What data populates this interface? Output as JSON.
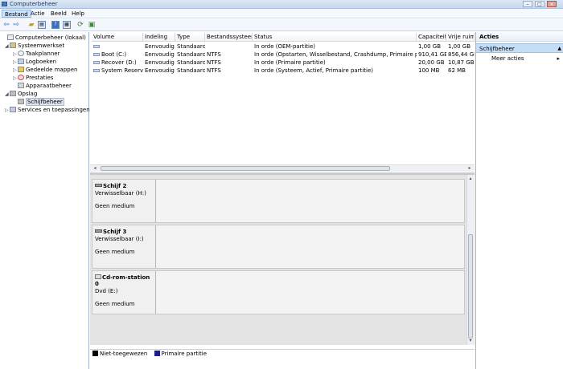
{
  "window": {
    "title": "Computerbeheer"
  },
  "menu": [
    {
      "label": "Bestand",
      "active": true
    },
    {
      "label": "Actie",
      "active": false
    },
    {
      "label": "Beeld",
      "active": false
    },
    {
      "label": "Help",
      "active": false
    }
  ],
  "toolbar": {
    "icons": [
      "back-arrow-icon",
      "forward-arrow-icon",
      "up-folder-icon",
      "console-tree-icon",
      "help-icon",
      "properties-icon",
      "refresh-icon",
      "export-icon"
    ]
  },
  "tree": [
    {
      "label": "Computerbeheer (lokaal)",
      "level": 0,
      "expander": "",
      "icon": "computer-icon"
    },
    {
      "label": "Systeemwerkset",
      "level": 1,
      "expander": "◢",
      "icon": "tools-icon"
    },
    {
      "label": "Taakplanner",
      "level": 2,
      "expander": "▷",
      "icon": "clock-icon"
    },
    {
      "label": "Logboeken",
      "level": 2,
      "expander": "▷",
      "icon": "log-icon"
    },
    {
      "label": "Gedeelde mappen",
      "level": 2,
      "expander": "▷",
      "icon": "shared-folder-icon"
    },
    {
      "label": "Prestaties",
      "level": 2,
      "expander": "▷",
      "icon": "performance-icon"
    },
    {
      "label": "Apparaatbeheer",
      "level": 2,
      "expander": "",
      "icon": "device-manager-icon"
    },
    {
      "label": "Opslag",
      "level": 1,
      "expander": "◢",
      "icon": "storage-icon"
    },
    {
      "label": "Schijfbeheer",
      "level": 2,
      "expander": "",
      "icon": "disk-management-icon",
      "selected": true
    },
    {
      "label": "Services en toepassingen",
      "level": 1,
      "expander": "▷",
      "icon": "services-icon"
    }
  ],
  "table": {
    "columns": [
      "Volume",
      "Indeling",
      "Type",
      "Bestandssysteem",
      "Status",
      "Capaciteit",
      "Vrije ruim"
    ],
    "rows": [
      [
        "",
        "Eenvoudig",
        "Standaard",
        "",
        "In orde (OEM-partitie)",
        "1,00 GB",
        "1,00 GB"
      ],
      [
        "Boot (C:)",
        "Eenvoudig",
        "Standaard",
        "NTFS",
        "In orde (Opstarten, Wisselbestand, Crashdump, Primaire partitie)",
        "910,41 GB",
        "856,44 GB"
      ],
      [
        "Recover (D:)",
        "Eenvoudig",
        "Standaard",
        "NTFS",
        "In orde (Primaire partitie)",
        "20,00 GB",
        "10,87 GB"
      ],
      [
        "System Reserved",
        "Eenvoudig",
        "Standaard",
        "NTFS",
        "In orde (Systeem, Actief, Primaire partitie)",
        "100 MB",
        "62 MB"
      ]
    ]
  },
  "disks": [
    {
      "name": "Schijf 2",
      "sub": "Verwisselbaar (H:)",
      "status": "Geen medium",
      "icon": "disk-icon"
    },
    {
      "name": "Schijf 3",
      "sub": "Verwisselbaar (I:)",
      "status": "Geen medium",
      "icon": "disk-icon"
    },
    {
      "name": "Cd-rom-station 0",
      "sub": "Dvd (E:)",
      "status": "Geen medium",
      "icon": "cd-rom-icon"
    }
  ],
  "legend": [
    {
      "label": "Niet-toegewezen",
      "color": "#000000"
    },
    {
      "label": "Primaire partitie",
      "color": "#1d1d8c"
    }
  ],
  "actions": {
    "header": "Acties",
    "section": "Schijfbeheer",
    "more": "Meer acties"
  }
}
